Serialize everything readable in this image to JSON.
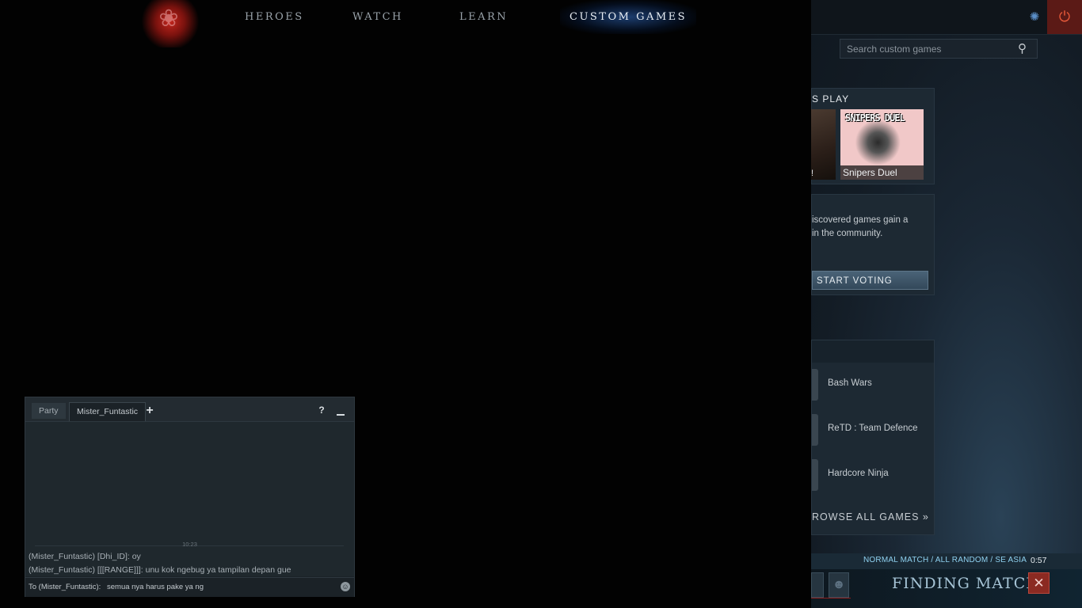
{
  "nav": {
    "heroes": "HEROES",
    "watch": "WATCH",
    "learn": "LEARN",
    "custom_games": "CUSTOM GAMES"
  },
  "search": {
    "placeholder": "Search custom games"
  },
  "friends_play": {
    "header": "S PLAY",
    "games": [
      {
        "label": "!"
      },
      {
        "label": "Snipers Duel",
        "logo_text": "SNIPERS DUEL"
      }
    ]
  },
  "voting": {
    "text_line1": "iscovered games gain a",
    "text_line2": "in the community.",
    "button": "START VOTING"
  },
  "game_list": {
    "items": [
      "Bash Wars",
      "ReTD : Team Defence",
      "Hardcore Ninja"
    ],
    "browse_all": "ROWSE ALL GAMES »"
  },
  "matchmaking": {
    "mode": "NORMAL MATCH / ALL RANDOM / SE ASIA",
    "time": "0:57",
    "status": "FINDING MATCH"
  },
  "chat": {
    "tabs": [
      "Party",
      "Mister_Funtastic"
    ],
    "help": "?",
    "timestamp": "10:23",
    "messages": [
      "(Mister_Funtastic) [Dhi_ID]: oy",
      "(Mister_Funtastic) [[[RANGE]]]: unu kok ngebug ya tampilan depan gue"
    ],
    "input_prefix": "To (Mister_Funtastic):",
    "input_value": "semua nya harus pake ya ng"
  },
  "colors": {
    "accent_blue": "#8fd1f0",
    "cancel_red": "#8b2a22",
    "power_red": "#e85a3a"
  }
}
